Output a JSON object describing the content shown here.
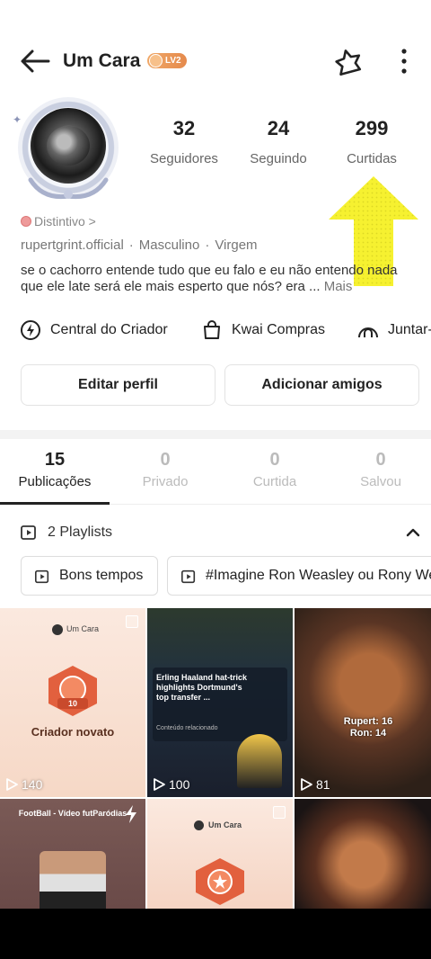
{
  "header": {
    "title": "Um Cara",
    "level_badge": "LV2"
  },
  "stats": [
    {
      "value": "32",
      "label": "Seguidores"
    },
    {
      "value": "24",
      "label": "Seguindo"
    },
    {
      "value": "299",
      "label": "Curtidas"
    }
  ],
  "profile": {
    "badge_link": "Distintivo >",
    "username": "rupertgrint.official",
    "gender": "Masculino",
    "sign": "Virgem",
    "separator": "·",
    "bio": "se o cachorro entende tudo que eu falo e eu não entendo nada que ele late será ele mais esperto que nós? era ...",
    "bio_more": "Mais"
  },
  "shortcuts": [
    {
      "label": "Central do Criador",
      "icon": "lightning-circle-icon"
    },
    {
      "label": "Kwai Compras",
      "icon": "shopping-bag-icon"
    },
    {
      "label": "Juntar-",
      "icon": "community-icon"
    }
  ],
  "actions": {
    "edit_profile": "Editar perfil",
    "add_friends": "Adicionar amigos"
  },
  "tabs": [
    {
      "count": "15",
      "label": "Publicações",
      "active": true
    },
    {
      "count": "0",
      "label": "Privado",
      "active": false
    },
    {
      "count": "0",
      "label": "Curtida",
      "active": false
    },
    {
      "count": "0",
      "label": "Salvou",
      "active": false
    }
  ],
  "playlists": {
    "header": "2 Playlists",
    "items": [
      "Bons tempos",
      "#Imagine Ron Weasley ou Rony We"
    ]
  },
  "videos": [
    {
      "views": "140",
      "header": "Um Cara",
      "title": "Criador novato",
      "medal_number": "10"
    },
    {
      "views": "100",
      "title": "Erling Haaland hat-trick highlights Dortmund's top transfer ...",
      "related": "Conteúdo relacionado"
    },
    {
      "views": "81",
      "caption": "Rupert: 16 Ron: 14"
    },
    {
      "caption": "FootBall - Vídeo futParódias"
    },
    {
      "header": "Um Cara"
    },
    {}
  ],
  "colors": {
    "accent_level": "#e58a4c",
    "highlight_arrow": "#f5f01e",
    "text_primary": "#222222",
    "text_secondary": "#777777"
  }
}
